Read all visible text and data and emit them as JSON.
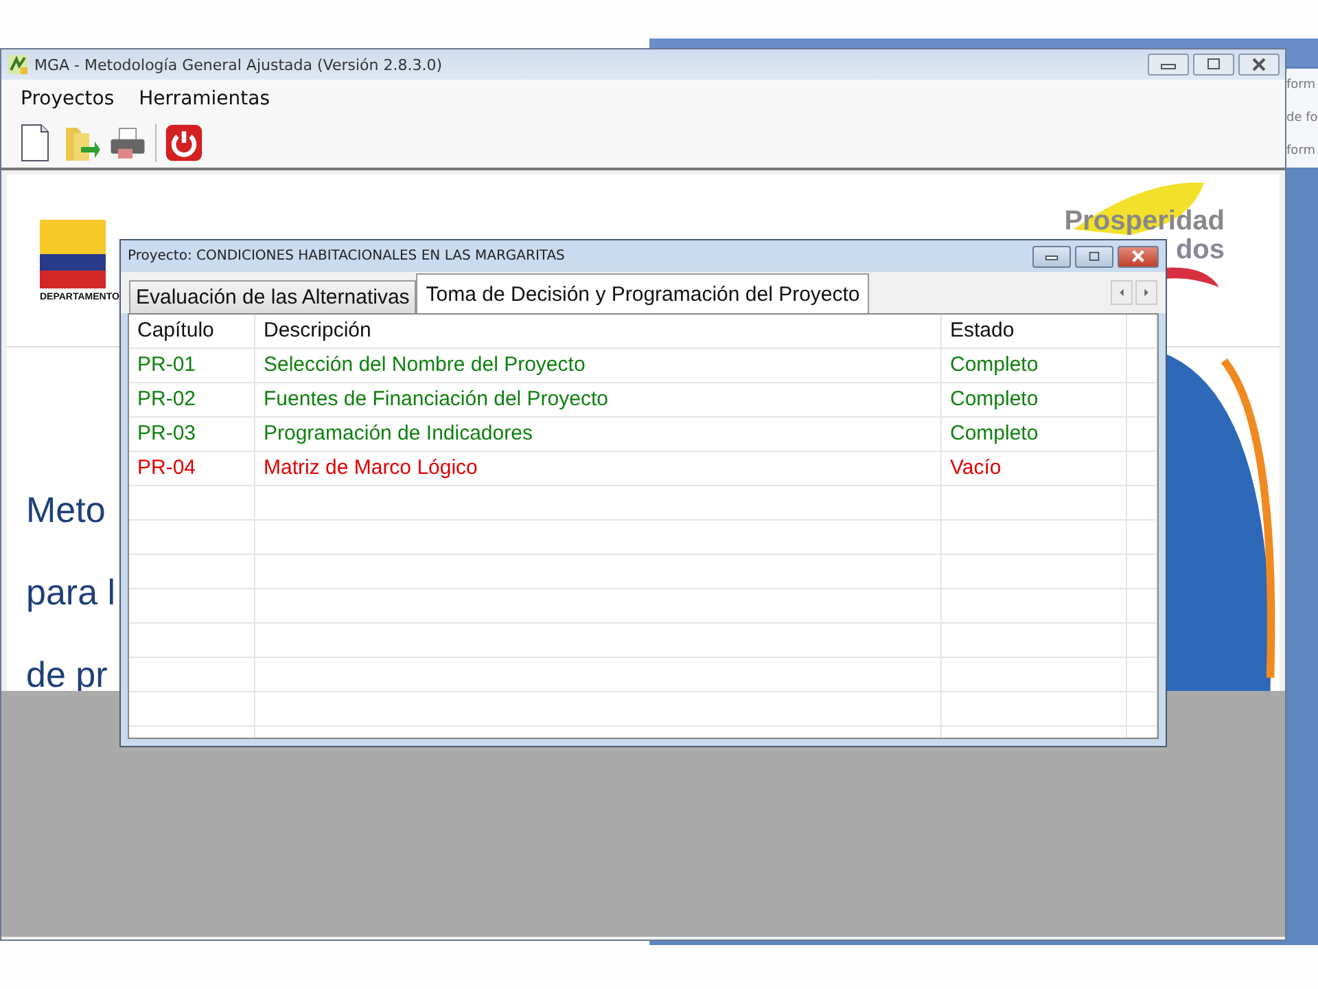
{
  "window": {
    "title": "MGA - Metodología General Ajustada (Versión 2.8.3.0)"
  },
  "menu": [
    "Proyectos",
    "Herramientas"
  ],
  "background_window": {
    "side_texts": [
      "form",
      "de fo",
      "form"
    ]
  },
  "banner": {
    "logo_caption": "DEPARTAMENTO",
    "right_logo": [
      "Prosperidad",
      "dos"
    ],
    "headline_lines": [
      "Meto",
      "para l",
      "de pr"
    ]
  },
  "dialog": {
    "title": "Proyecto: CONDICIONES HABITACIONALES EN LAS MARGARITAS",
    "tabs": [
      {
        "label": "Evaluación de las Alternativas",
        "selected": false
      },
      {
        "label": "Toma de Decisión y Programación del Proyecto",
        "selected": true
      }
    ],
    "table": {
      "columns": [
        "Capítulo",
        "Descripción",
        "Estado"
      ],
      "rows": [
        {
          "chapter": "PR-01",
          "description": "Selección del Nombre del Proyecto",
          "status": "Completo",
          "kind": "complete"
        },
        {
          "chapter": "PR-02",
          "description": "Fuentes de Financiación del Proyecto",
          "status": "Completo",
          "kind": "complete"
        },
        {
          "chapter": "PR-03",
          "description": "Programación de Indicadores",
          "status": "Completo",
          "kind": "complete"
        },
        {
          "chapter": "PR-04",
          "description": "Matriz de Marco Lógico",
          "status": "Vacío",
          "kind": "empty"
        }
      ]
    }
  }
}
